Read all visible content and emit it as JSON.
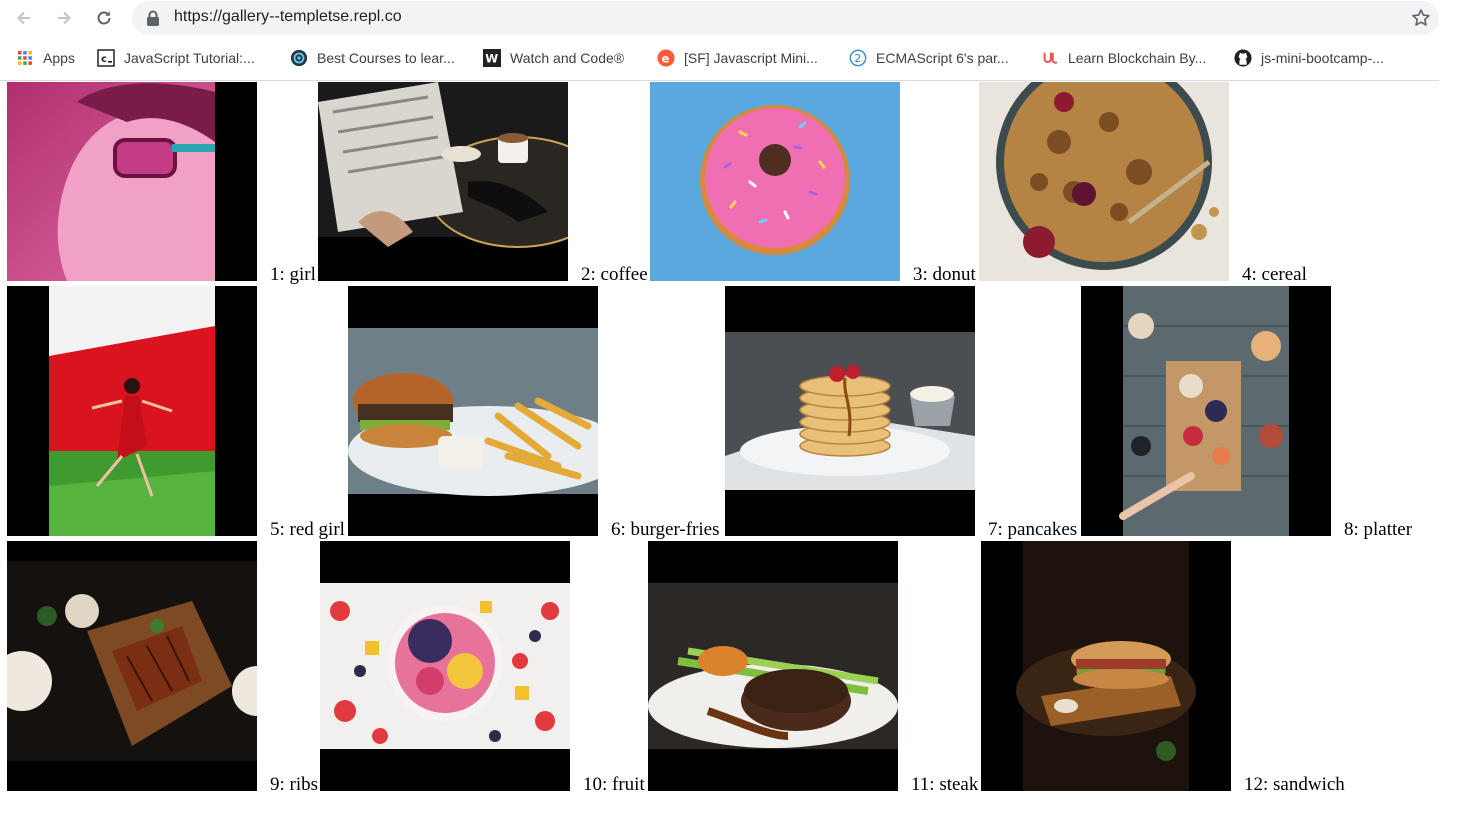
{
  "browser": {
    "url": "https://gallery--templetse.repl.co"
  },
  "bookmarks": [
    {
      "label": "Apps",
      "icon": "apps-grid-icon"
    },
    {
      "label": "JavaScript Tutorial:...",
      "icon": "codecademy-icon"
    },
    {
      "label": "Best Courses to lear...",
      "icon": "course-logo-icon"
    },
    {
      "label": "Watch and Code®",
      "icon": "w-logo-icon"
    },
    {
      "label": "[SF] Javascript Mini...",
      "icon": "e-logo-icon"
    },
    {
      "label": "ECMAScript 6's par...",
      "icon": "circled-two-icon"
    },
    {
      "label": "Learn Blockchain By...",
      "icon": "u-logo-icon"
    },
    {
      "label": "js-mini-bootcamp-...",
      "icon": "github-icon"
    }
  ],
  "gallery": [
    {
      "caption": "1: girl",
      "subject": "woman with pink sunglasses"
    },
    {
      "caption": "2: coffee",
      "subject": "newspaper and coffee"
    },
    {
      "caption": "3: donut",
      "subject": "pink sprinkled donut"
    },
    {
      "caption": "4: cereal",
      "subject": "granola bowl"
    },
    {
      "caption": "5: red girl",
      "subject": "woman in red dress dancing"
    },
    {
      "caption": "6: burger-fries",
      "subject": "burger with fries"
    },
    {
      "caption": "7: pancakes",
      "subject": "pancake stack"
    },
    {
      "caption": "8: platter",
      "subject": "charcuterie platter"
    },
    {
      "caption": "9: ribs",
      "subject": "grilled ribs on board"
    },
    {
      "caption": "10: fruit",
      "subject": "fruit bowl"
    },
    {
      "caption": "11: steak",
      "subject": "steak with asparagus"
    },
    {
      "caption": "12: sandwich",
      "subject": "sandwich on board"
    }
  ],
  "colors": {
    "omnibox_bg": "#f1f3f4",
    "chrome_icon": "#5f6368",
    "photo_letterbox": "#000000"
  }
}
